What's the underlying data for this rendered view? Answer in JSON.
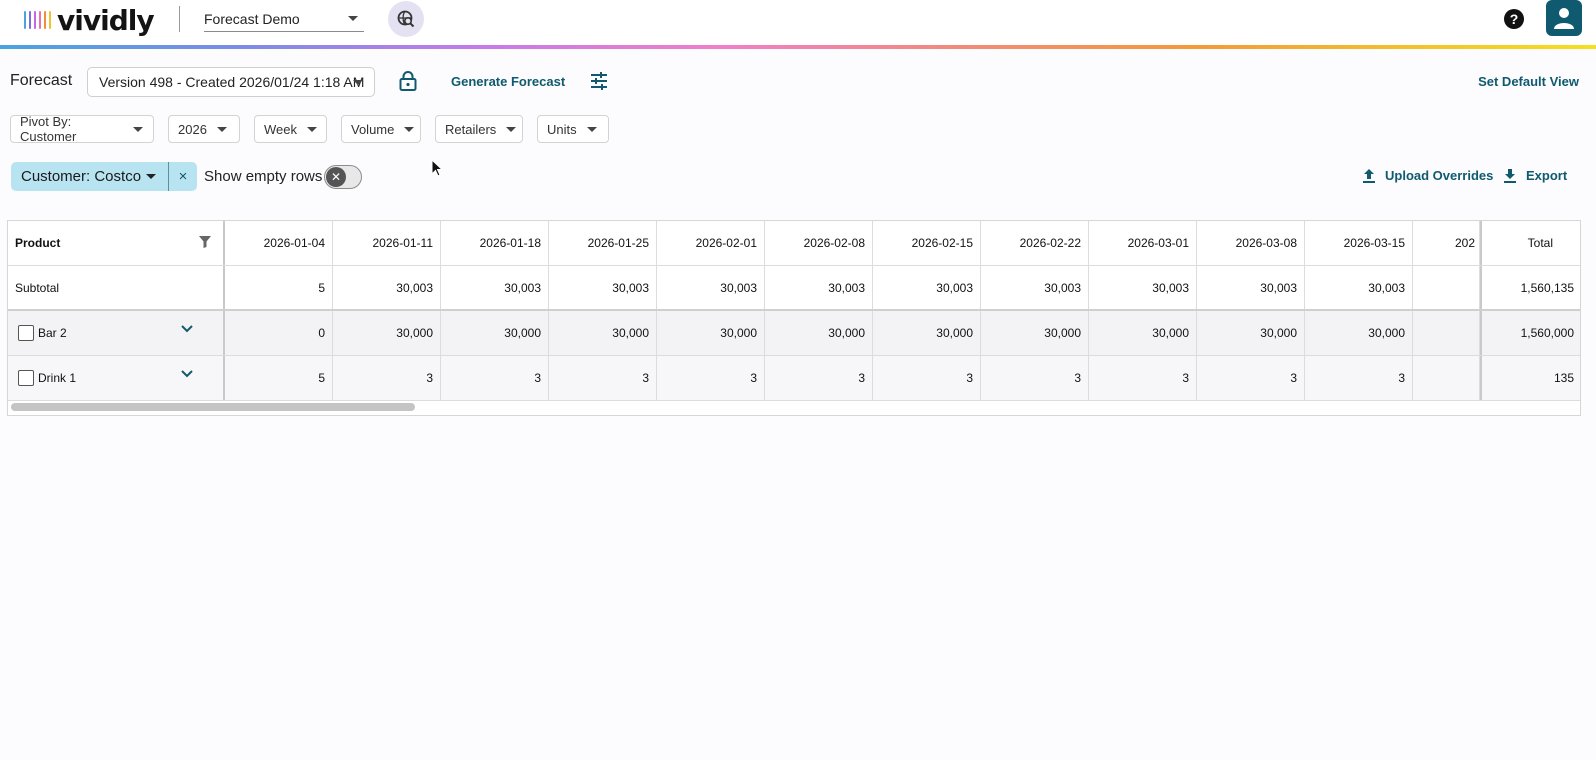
{
  "header": {
    "logo_text": "vividly",
    "workspace": "Forecast Demo",
    "help_label": "?"
  },
  "toolbar": {
    "forecast_label": "Forecast",
    "version": "Version 498 - Created 2026/01/24 1:18 AM",
    "generate_label": "Generate Forecast",
    "set_default_label": "Set Default View"
  },
  "filters": [
    {
      "label": "Pivot By: Customer"
    },
    {
      "label": "2026"
    },
    {
      "label": "Week"
    },
    {
      "label": "Volume"
    },
    {
      "label": "Retailers"
    },
    {
      "label": "Units"
    }
  ],
  "customer_chip": {
    "label": "Customer: Costco",
    "remove": "×"
  },
  "show_empty_rows": {
    "label": "Show empty rows",
    "enabled": false
  },
  "actions": {
    "upload_label": "Upload Overrides",
    "export_label": "Export"
  },
  "table": {
    "product_header": "Product",
    "columns": [
      "2026-01-04",
      "2026-01-11",
      "2026-01-18",
      "2026-01-25",
      "2026-02-01",
      "2026-02-08",
      "2026-02-15",
      "2026-02-22",
      "2026-03-01",
      "2026-03-08",
      "2026-03-15",
      "202"
    ],
    "total_header": "Total",
    "subtotal": {
      "label": "Subtotal",
      "values": [
        "5",
        "30,003",
        "30,003",
        "30,003",
        "30,003",
        "30,003",
        "30,003",
        "30,003",
        "30,003",
        "30,003",
        "30,003",
        ""
      ],
      "total": "1,560,135"
    },
    "rows": [
      {
        "label": "Bar 2",
        "values": [
          "0",
          "30,000",
          "30,000",
          "30,000",
          "30,000",
          "30,000",
          "30,000",
          "30,000",
          "30,000",
          "30,000",
          "30,000",
          ""
        ],
        "total": "1,560,000"
      },
      {
        "label": "Drink 1",
        "values": [
          "5",
          "3",
          "3",
          "3",
          "3",
          "3",
          "3",
          "3",
          "3",
          "3",
          "3",
          ""
        ],
        "total": "135"
      }
    ]
  },
  "colors": {
    "accent": "#0f5a6e",
    "chip": "#b8e4f2"
  }
}
